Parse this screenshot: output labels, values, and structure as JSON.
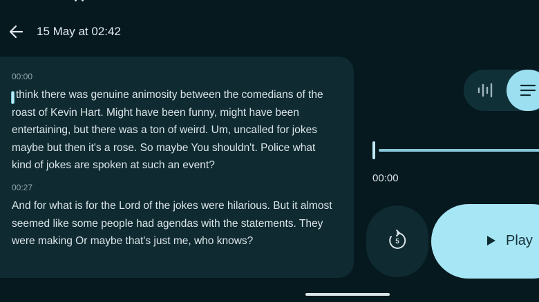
{
  "header": {
    "title": "15 May at 02:42"
  },
  "transcript": {
    "segments": [
      {
        "time": "00:00",
        "text": "think there was genuine animosity between the comedians of the roast of Kevin Hart. Might have been funny, might have been entertaining, but there was a ton of weird. Um, uncalled for jokes maybe but then it's a rose. So maybe You shouldn't. Police what kind of jokes are spoken at such an event?"
      },
      {
        "time": "00:27",
        "text": "And for what is for the Lord of the jokes were hilarious. But it almost seemed like some people had agendas with the statements. They were making Or maybe that's just me, who knows?"
      }
    ],
    "selected_leading_char": "I"
  },
  "view_toggle": {
    "options": [
      "waveform",
      "transcript"
    ],
    "selected": "transcript"
  },
  "player": {
    "current_time": "00:00",
    "progress": 0,
    "rewind_seconds": "5",
    "play_label": "Play"
  },
  "colors": {
    "background": "#06191f",
    "panel": "#0f2a31",
    "accent": "#a6e6f5"
  },
  "icons": {
    "back": "arrow-left-icon",
    "waveform": "waveform-icon",
    "transcript": "text-lines-icon",
    "rewind": "rewind-5-icon",
    "play": "play-icon"
  }
}
